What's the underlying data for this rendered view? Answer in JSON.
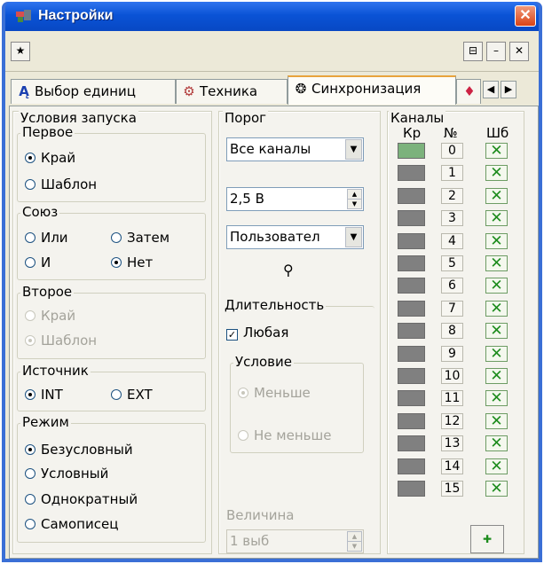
{
  "window": {
    "title": "Настройки",
    "close_glyph": "✕"
  },
  "toolbar": {
    "left_icon": "star-icon",
    "right_icons": [
      "reset-icon",
      "minimize-icon",
      "close-x-icon"
    ]
  },
  "tabs": [
    {
      "label": "Выбор единиц",
      "icon": "units-icon"
    },
    {
      "label": "Техника",
      "icon": "hardware-icon"
    },
    {
      "label": "Синхронизация",
      "icon": "sync-icon",
      "active": true
    },
    {
      "label": "",
      "icon": "paint-icon"
    }
  ],
  "launch": {
    "title": "Условия запуска",
    "first": {
      "title": "Первое",
      "options": [
        "Край",
        "Шаблон"
      ],
      "selected": "Край"
    },
    "union": {
      "title": "Союз",
      "options": [
        "Или",
        "Затем",
        "И",
        "Нет"
      ],
      "selected": "Нет"
    },
    "second": {
      "title": "Второе",
      "options": [
        "Край",
        "Шаблон"
      ],
      "selected": "Шаблон",
      "disabled": true
    },
    "source": {
      "title": "Источник",
      "options": [
        "INT",
        "EXT"
      ],
      "selected": "INT"
    },
    "mode": {
      "title": "Режим",
      "options": [
        "Безусловный",
        "Условный",
        "Однократный",
        "Самописец"
      ],
      "selected": "Безусловный"
    }
  },
  "threshold": {
    "title": "Порог",
    "channel_select": "Все каналы",
    "voltage": "2,5 В",
    "preset_select": "Пользовател",
    "search_icon": "binoculars-icon"
  },
  "duration": {
    "title": "Длительность",
    "any_label": "Любая",
    "any_checked": true,
    "condition": {
      "title": "Условие",
      "options": [
        "Меньше",
        "Не меньше"
      ],
      "selected": "Меньше",
      "disabled": true
    },
    "value_label": "Величина",
    "value": "1 выб"
  },
  "channels": {
    "title": "Каналы",
    "headers": [
      "Кр",
      "№",
      "Шб"
    ],
    "rows": [
      {
        "n": "0",
        "kr": true,
        "sb": "✕"
      },
      {
        "n": "1",
        "kr": false,
        "sb": "✕"
      },
      {
        "n": "2",
        "kr": false,
        "sb": "✕"
      },
      {
        "n": "3",
        "kr": false,
        "sb": "✕"
      },
      {
        "n": "4",
        "kr": false,
        "sb": "✕"
      },
      {
        "n": "5",
        "kr": false,
        "sb": "✕"
      },
      {
        "n": "6",
        "kr": false,
        "sb": "✕"
      },
      {
        "n": "7",
        "kr": false,
        "sb": "✕"
      },
      {
        "n": "8",
        "kr": false,
        "sb": "✕"
      },
      {
        "n": "9",
        "kr": false,
        "sb": "✕"
      },
      {
        "n": "10",
        "kr": false,
        "sb": "✕"
      },
      {
        "n": "11",
        "kr": false,
        "sb": "✕"
      },
      {
        "n": "12",
        "kr": false,
        "sb": "✕"
      },
      {
        "n": "13",
        "kr": false,
        "sb": "✕"
      },
      {
        "n": "14",
        "kr": false,
        "sb": "✕"
      },
      {
        "n": "15",
        "kr": false,
        "sb": "✕"
      }
    ],
    "add_icon": "add-channel-icon"
  }
}
